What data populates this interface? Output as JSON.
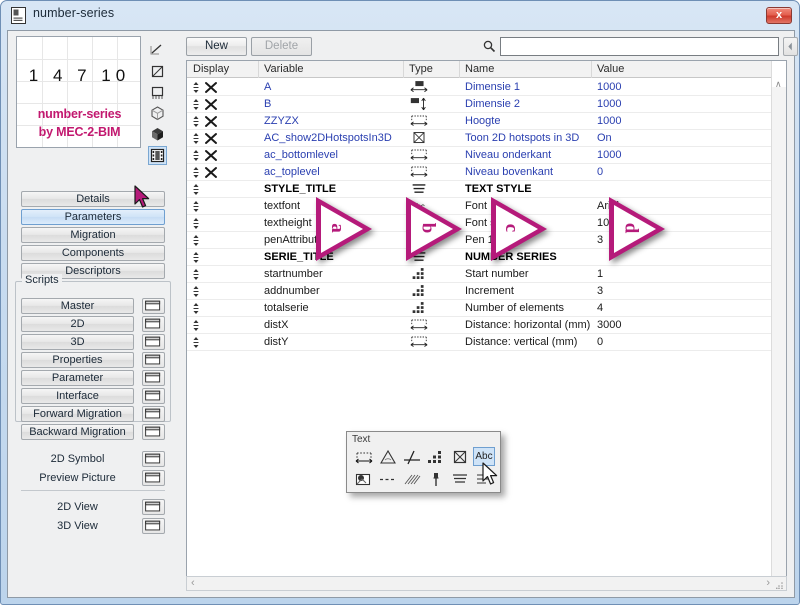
{
  "window": {
    "title": "number-series",
    "title_icon": "document-icon",
    "close_label": "x"
  },
  "preview": {
    "numbers": "1  4  7  10",
    "label_line1": "number-series",
    "label_line2": "by MEC-2-BIM",
    "accent_color": "#c2186f",
    "icons": [
      {
        "name": "line-tool-icon"
      },
      {
        "name": "square-tool-icon"
      },
      {
        "name": "plan-view-icon"
      },
      {
        "name": "wireframe-cube-icon"
      },
      {
        "name": "solid-cube-icon"
      },
      {
        "name": "film-strip-icon"
      }
    ],
    "selected_icon_index": 5
  },
  "sidebar": {
    "main_buttons": [
      {
        "label": "Details",
        "active": false
      },
      {
        "label": "Parameters",
        "active": true
      },
      {
        "label": "Migration",
        "active": false
      },
      {
        "label": "Components",
        "active": false
      },
      {
        "label": "Descriptors",
        "active": false
      }
    ],
    "scripts_legend": "Scripts",
    "script_buttons": [
      {
        "label": "Master"
      },
      {
        "label": "2D"
      },
      {
        "label": "3D"
      },
      {
        "label": "Properties"
      },
      {
        "label": "Parameter"
      },
      {
        "label": "Interface"
      },
      {
        "label": "Forward Migration"
      },
      {
        "label": "Backward Migration"
      }
    ],
    "picture_buttons": [
      {
        "label": "2D Symbol"
      },
      {
        "label": "Preview Picture"
      }
    ],
    "view_buttons": [
      {
        "label": "2D View"
      },
      {
        "label": "3D View"
      }
    ]
  },
  "toolbar": {
    "new_label": "New",
    "delete_label": "Delete",
    "search_icon": "search-icon",
    "search_value": "",
    "search_placeholder": "",
    "prev_label": "◀",
    "next_label": "▶"
  },
  "table": {
    "columns": [
      "Display",
      "Variable",
      "Type",
      "Name",
      "Value"
    ],
    "rows": [
      {
        "display": "sortable-deletable",
        "variable": "A",
        "type": "dimension-horizontal-icon",
        "name": "Dimensie 1",
        "value": "1000",
        "style": "blue"
      },
      {
        "display": "sortable-deletable",
        "variable": "B",
        "type": "dimension-vertical-icon",
        "name": "Dimensie 2",
        "value": "1000",
        "style": "blue"
      },
      {
        "display": "sortable-deletable",
        "variable": "ZZYZX",
        "type": "length-icon",
        "name": "Hoogte",
        "value": "1000",
        "style": "blue"
      },
      {
        "display": "sortable-deletable",
        "variable": "AC_show2DHotspotsIn3D",
        "type": "boolean-icon",
        "name": "Toon 2D hotspots in 3D",
        "value": "On",
        "style": "blue"
      },
      {
        "display": "sortable-deletable",
        "variable": "ac_bottomlevel",
        "type": "length-icon",
        "name": "Niveau onderkant",
        "value": "1000",
        "style": "blue"
      },
      {
        "display": "sortable-deletable",
        "variable": "ac_toplevel",
        "type": "length-icon",
        "name": "Niveau bovenkant",
        "value": "0",
        "style": "blue"
      },
      {
        "display": "sortable",
        "variable": "STYLE_TITLE",
        "type": "title-icon",
        "name": "TEXT STYLE",
        "value": "",
        "style": "bold"
      },
      {
        "display": "sortable",
        "variable": "textfont",
        "type": "text-icon",
        "name": "Font",
        "value": "Arial",
        "style": "black"
      },
      {
        "display": "sortable",
        "variable": "textheight",
        "type": "length-icon",
        "name": "Font size",
        "value": "10",
        "style": "black"
      },
      {
        "display": "sortable",
        "variable": "penAttribute",
        "type": "pen-icon",
        "name": "Pen 1",
        "value": "3",
        "style": "black"
      },
      {
        "display": "sortable",
        "variable": "SERIE_TITLE",
        "type": "title-icon",
        "name": "NUMBER SERIES",
        "value": "",
        "style": "bold"
      },
      {
        "display": "sortable",
        "variable": "startnumber",
        "type": "integer-icon",
        "name": "Start number",
        "value": "1",
        "style": "black"
      },
      {
        "display": "sortable",
        "variable": "addnumber",
        "type": "integer-icon",
        "name": "Increment",
        "value": "3",
        "style": "black"
      },
      {
        "display": "sortable",
        "variable": "totalserie",
        "type": "integer-icon",
        "name": "Number of elements",
        "value": "4",
        "style": "black"
      },
      {
        "display": "sortable",
        "variable": "distX",
        "type": "length-icon",
        "name": "Distance: horizontal (mm)",
        "value": "3000",
        "style": "black"
      },
      {
        "display": "sortable",
        "variable": "distY",
        "type": "length-icon",
        "name": "Distance: vertical (mm)",
        "value": "0",
        "style": "black"
      }
    ]
  },
  "annotations": [
    {
      "letter": "a"
    },
    {
      "letter": "b"
    },
    {
      "letter": "c"
    },
    {
      "letter": "d"
    }
  ],
  "text_toolbar": {
    "title": "Text",
    "icons_row1": [
      {
        "name": "length-icon",
        "selected": false
      },
      {
        "name": "angle-icon",
        "selected": false
      },
      {
        "name": "point-icon",
        "selected": false
      },
      {
        "name": "integer-icon",
        "selected": false
      },
      {
        "name": "boolean-icon",
        "selected": false
      },
      {
        "name": "abc-text-icon",
        "label": "Abc",
        "selected": true
      }
    ],
    "icons_row2": [
      {
        "name": "material-icon",
        "selected": false
      },
      {
        "name": "line-type-icon",
        "selected": false
      },
      {
        "name": "fill-pattern-icon",
        "selected": false
      },
      {
        "name": "pen-icon",
        "selected": false
      },
      {
        "name": "title-icon",
        "selected": false
      },
      {
        "name": "paragraph-icon",
        "selected": false
      }
    ]
  },
  "scrollbars": {
    "vertical_up": "∧",
    "horizontal_left": "‹",
    "horizontal_right": "›"
  },
  "colors": {
    "accent_magenta": "#b51a7a",
    "title_gradient_top": "#d8e6f5",
    "selection_blue": "#cfe3f7",
    "link_blue": "#2a3fb0"
  }
}
